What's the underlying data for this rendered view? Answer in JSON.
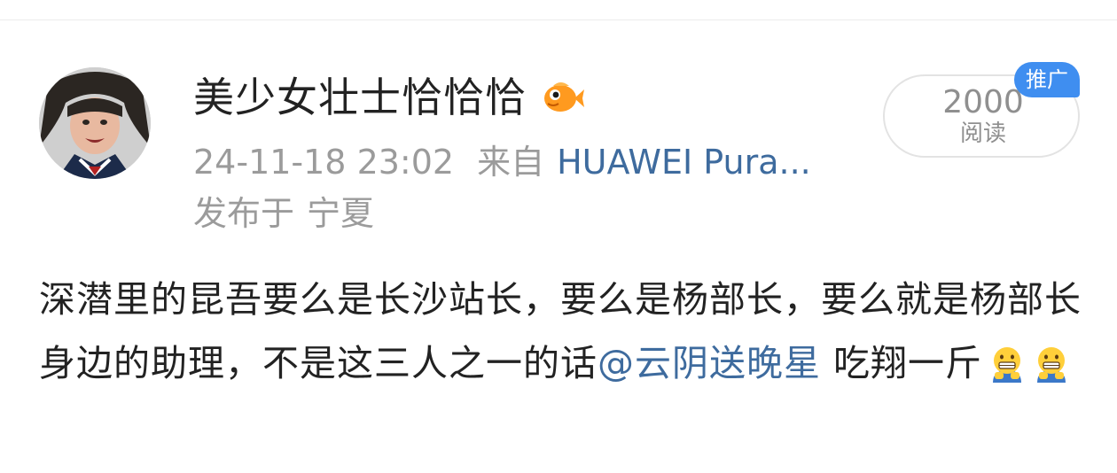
{
  "post": {
    "author": "美少女壮士恰恰恰",
    "badge_icon": "fish-badge-icon",
    "timestamp": "24-11-18 23:02",
    "source_prefix": "来自",
    "source_device": "HUAWEI Pura...",
    "location_prefix": "发布于",
    "location": "宁夏",
    "read_count": "2000",
    "read_label": "阅读",
    "promo_tag": "推广",
    "content_main": "深潜里的昆吾要么是长沙站长，要么是杨部长，要么就是杨部长身边的助理，不是这三人之一的话",
    "mention": "@云阴送晚星",
    "content_tail": "吃翔一斤",
    "emojis": [
      "grimace-emoji-icon",
      "grimace-emoji-icon"
    ]
  },
  "colors": {
    "link": "#3e6b9e",
    "promo": "#3f8ef0",
    "muted": "#9b9b9b",
    "text": "#222222"
  }
}
